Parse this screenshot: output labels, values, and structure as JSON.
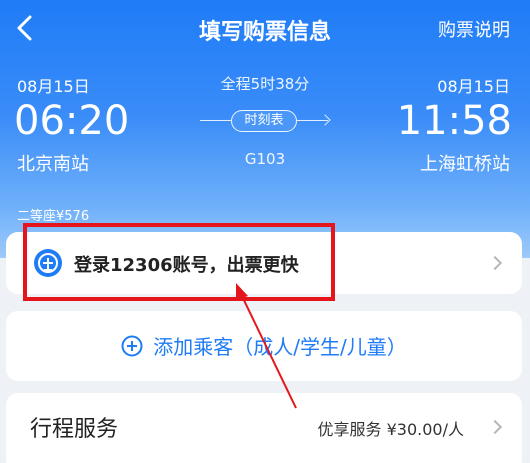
{
  "header": {
    "title": "填写购票信息",
    "help_label": "购票说明"
  },
  "trip": {
    "depart": {
      "date": "08月15日",
      "time": "06:20",
      "station": "北京南站"
    },
    "arrive": {
      "date": "08月15日",
      "time": "11:58",
      "station": "上海虹桥站"
    },
    "duration": "全程5时38分",
    "timetable_label": "时刻表",
    "train_no": "G103",
    "seat_price": "二等座¥576"
  },
  "login": {
    "text": "登录12306账号，出票更快"
  },
  "passenger": {
    "add_label": "添加乘客（成人/学生/儿童）"
  },
  "service": {
    "title": "行程服务",
    "info": "优享服务 ¥30.00/人"
  },
  "colors": {
    "brand_blue": "#1f7cf7",
    "highlight_red": "#e5161b"
  },
  "icons": [
    "back-arrow-icon",
    "rail-logo-icon",
    "chevron-right-icon",
    "plus-circle-icon",
    "annotation-arrow-icon"
  ]
}
